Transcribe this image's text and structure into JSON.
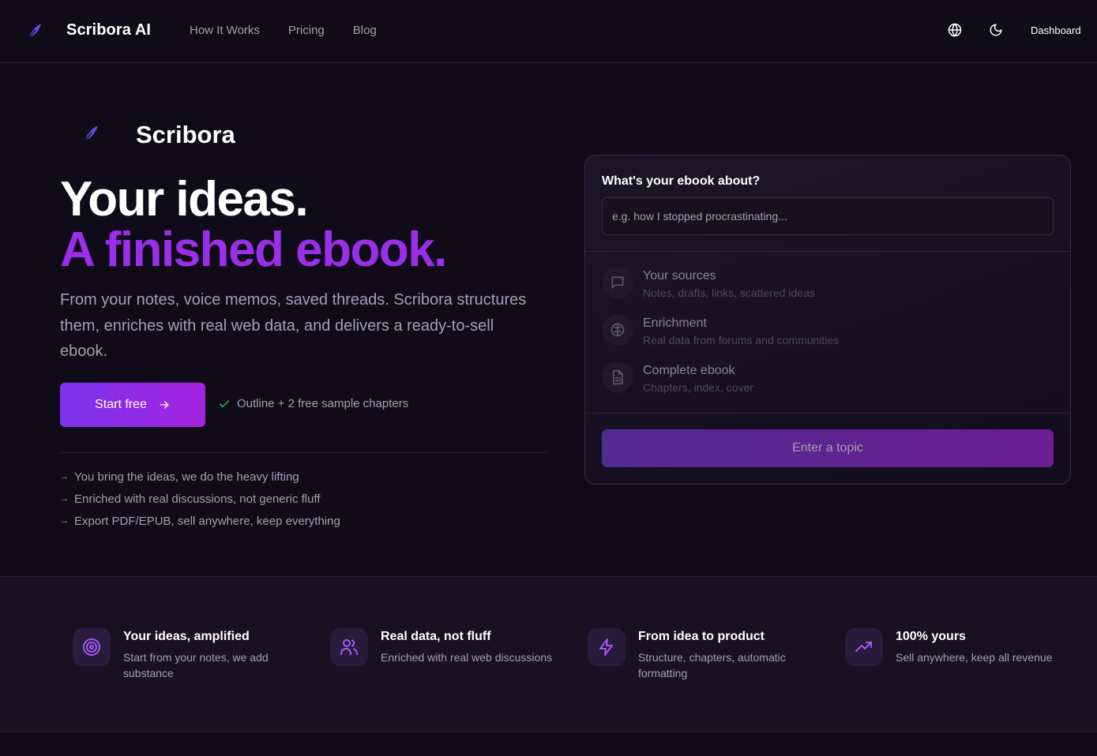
{
  "nav": {
    "brand": "Scribora AI",
    "links": [
      "How It Works",
      "Pricing",
      "Blog"
    ],
    "dashboard_label": "Dashboard",
    "icons": [
      "globe-icon",
      "moon-icon"
    ]
  },
  "hero": {
    "brand": "Scribora",
    "headline_line1": "Your ideas.",
    "headline_line2": "A finished ebook.",
    "subcopy": "From your notes, voice memos, saved threads. Scribora structures them, enriches with real web data, and delivers a ready-to-sell ebook.",
    "cta_label": "Start free",
    "cta_note": "Outline + 2 free sample chapters",
    "bullets": [
      "You bring the ideas, we do the heavy lifting",
      "Enriched with real discussions, not generic fluff",
      "Export PDF/EPUB, sell anywhere, keep everything"
    ]
  },
  "form": {
    "question": "What's your ebook about?",
    "input_value": "",
    "input_placeholder": "e.g. how I stopped procrastinating...",
    "steps": [
      {
        "title": "Your sources",
        "subtitle": "Notes, drafts, links, scattered ideas",
        "icon": "message-square-icon"
      },
      {
        "title": "Enrichment",
        "subtitle": "Real data from forums and communities",
        "icon": "brain-icon"
      },
      {
        "title": "Complete ebook",
        "subtitle": "Chapters, index, cover",
        "icon": "file-text-icon"
      }
    ],
    "submit_label": "Enter a topic"
  },
  "features": [
    {
      "title": "Your ideas, amplified",
      "desc": "Start from your notes, we add substance",
      "icon": "target-icon"
    },
    {
      "title": "Real data, not fluff",
      "desc": "Enriched with real web discussions",
      "icon": "users-icon"
    },
    {
      "title": "From idea to product",
      "desc": "Structure, chapters, automatic formatting",
      "icon": "zap-icon"
    },
    {
      "title": "100% yours",
      "desc": "Sell anywhere, keep all revenue",
      "icon": "trending-up-icon"
    }
  ],
  "colors": {
    "background": "#0f0b19",
    "accent": "#9b2ee8",
    "muted_text": "#a59eb8",
    "check": "#22c55e"
  }
}
